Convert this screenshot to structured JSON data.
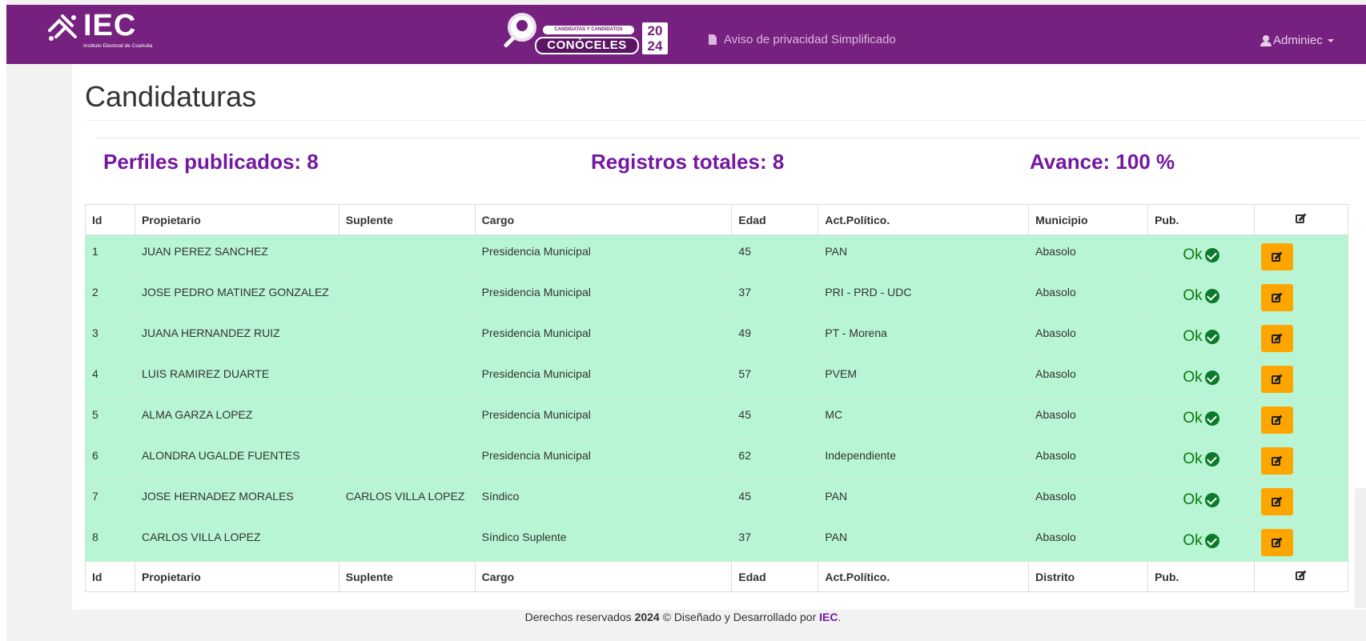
{
  "header": {
    "logo_text": "IEC",
    "logo_subtitle": "Instituto Electoral de Coahuila",
    "brand_tag": "CANDIDATAS Y CANDIDATOS",
    "brand_name": "CONÓCELES",
    "brand_year_top": "20",
    "brand_year_bottom": "24",
    "privacy_link": "Aviso de privacidad Simplificado",
    "user_menu": "Adminiec",
    "accent_color": "#76217f"
  },
  "page": {
    "title": "Candidaturas"
  },
  "stats": {
    "published": "Perfiles publicados: 8",
    "total": "Registros totales: 8",
    "progress": "Avance: 100 %"
  },
  "table": {
    "headers": [
      "Id",
      "Propietario",
      "Suplente",
      "Cargo",
      "Edad",
      "Act.Político.",
      "Municipio",
      "Pub."
    ],
    "footer_headers": [
      "Id",
      "Propietario",
      "Suplente",
      "Cargo",
      "Edad",
      "Act.Político.",
      "Distrito",
      "Pub."
    ],
    "rows": [
      {
        "id": "1",
        "propietario": "JUAN PEREZ SANCHEZ",
        "suplente": "",
        "cargo": "Presidencia Municipal",
        "edad": "45",
        "act": "PAN",
        "municipio": "Abasolo",
        "pub": "Ok"
      },
      {
        "id": "2",
        "propietario": "JOSE PEDRO MATINEZ GONZALEZ",
        "suplente": "",
        "cargo": "Presidencia Municipal",
        "edad": "37",
        "act": "PRI - PRD - UDC",
        "municipio": "Abasolo",
        "pub": "Ok"
      },
      {
        "id": "3",
        "propietario": "JUANA HERNANDEZ RUIZ",
        "suplente": "",
        "cargo": "Presidencia Municipal",
        "edad": "49",
        "act": "PT - Morena",
        "municipio": "Abasolo",
        "pub": "Ok"
      },
      {
        "id": "4",
        "propietario": "LUIS RAMIREZ DUARTE",
        "suplente": "",
        "cargo": "Presidencia Municipal",
        "edad": "57",
        "act": "PVEM",
        "municipio": "Abasolo",
        "pub": "Ok"
      },
      {
        "id": "5",
        "propietario": "ALMA GARZA LOPEZ",
        "suplente": "",
        "cargo": "Presidencia Municipal",
        "edad": "45",
        "act": "MC",
        "municipio": "Abasolo",
        "pub": "Ok"
      },
      {
        "id": "6",
        "propietario": "ALONDRA UGALDE FUENTES",
        "suplente": "",
        "cargo": "Presidencia Municipal",
        "edad": "62",
        "act": "Independiente",
        "municipio": "Abasolo",
        "pub": "Ok"
      },
      {
        "id": "7",
        "propietario": "JOSE HERNADEZ MORALES",
        "suplente": "CARLOS VILLA LOPEZ",
        "cargo": "Síndico",
        "edad": "45",
        "act": "PAN",
        "municipio": "Abasolo",
        "pub": "Ok"
      },
      {
        "id": "8",
        "propietario": "CARLOS VILLA LOPEZ",
        "suplente": "",
        "cargo": "Síndico Suplente",
        "edad": "37",
        "act": "PAN",
        "municipio": "Abasolo",
        "pub": "Ok"
      }
    ],
    "row_color": "#b8f5d4",
    "edit_button_color": "#ffa500"
  },
  "footer": {
    "prefix": "Derechos reservados ",
    "year": "2024",
    "middle": " © Diseñado y Desarrollado por ",
    "link": "IEC",
    "suffix": "."
  }
}
